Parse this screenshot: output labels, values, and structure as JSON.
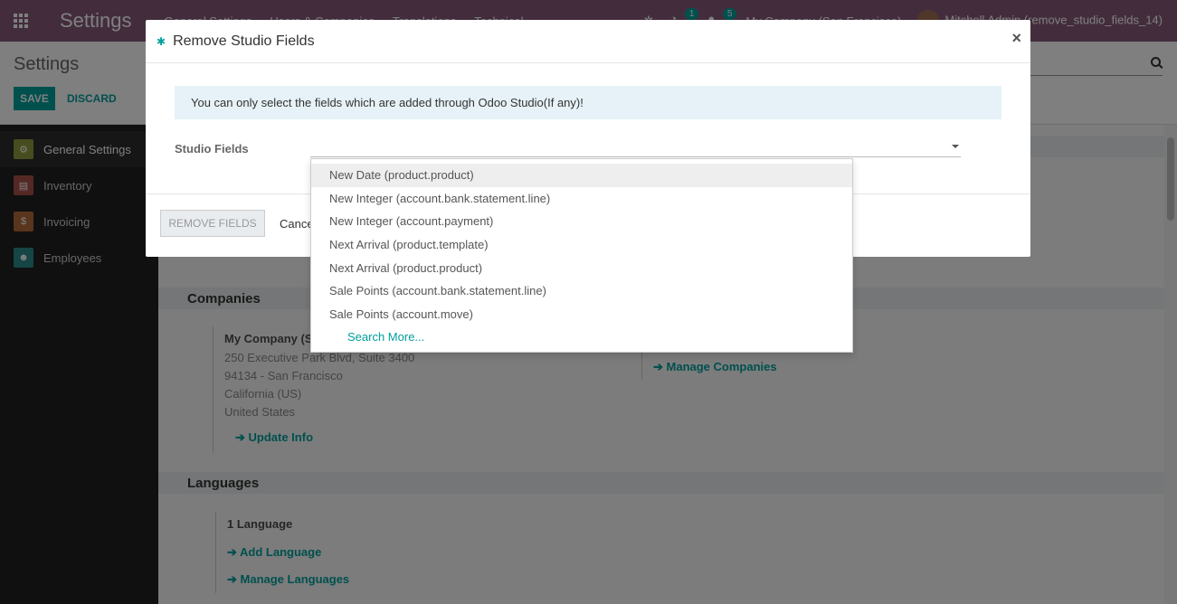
{
  "navbar": {
    "brand": "Settings",
    "menus": [
      "General Settings",
      "Users & Companies",
      "Translations",
      "Technical"
    ],
    "activity_count": "1",
    "messages_count": "5",
    "company": "My Company (San Francisco)",
    "user": "Mitchell Admin (remove_studio_fields_14)"
  },
  "control_panel": {
    "title": "Settings",
    "save_label": "SAVE",
    "discard_label": "DISCARD"
  },
  "sidebar": {
    "items": [
      {
        "label": "General Settings",
        "color": "#8f9b3c"
      },
      {
        "label": "Inventory",
        "color": "#a8504a"
      },
      {
        "label": "Invoicing",
        "color": "#b36b3b"
      },
      {
        "label": "Employees",
        "color": "#2b8d8a"
      }
    ]
  },
  "main": {
    "companies_header": "Companies",
    "company_name": "My Company (San Francisco)",
    "address": [
      "250 Executive Park Blvd, Suite 3400",
      "94134 - San Francisco",
      "California (US)",
      "United States"
    ],
    "update_info": "Update Info",
    "manage_companies": "Manage Companies",
    "languages_header": "Languages",
    "language_count": "1 Language",
    "add_language": "Add Language",
    "manage_languages": "Manage Languages"
  },
  "modal": {
    "title": "Remove Studio Fields",
    "close": "×",
    "alert": "You can only select the fields which are added through Odoo Studio(If any)!",
    "field_label": "Studio Fields",
    "remove_button": "REMOVE FIELDS",
    "cancel_button": "Cancel"
  },
  "dropdown": {
    "items": [
      "New Date (product.product)",
      "New Integer (account.bank.statement.line)",
      "New Integer (account.payment)",
      "Next Arrival (product.template)",
      "Next Arrival (product.product)",
      "Sale Points (account.bank.statement.line)",
      "Sale Points (account.move)"
    ],
    "search_more": "Search More..."
  }
}
